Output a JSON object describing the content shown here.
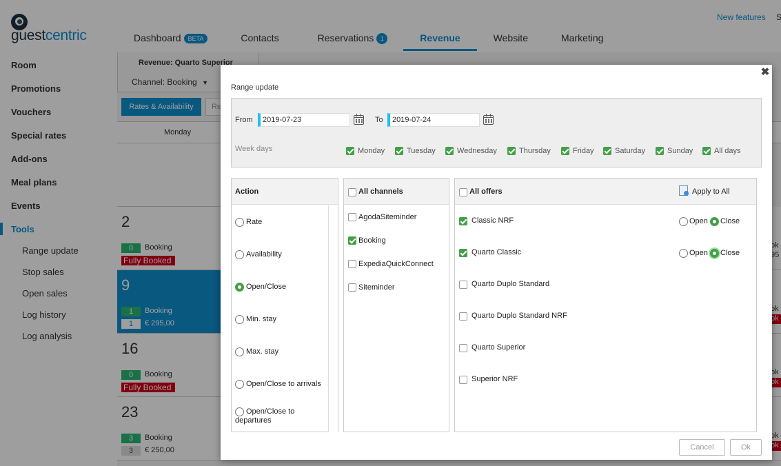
{
  "app": {
    "logo_word_a": "guest",
    "logo_word_b": "centric",
    "new_features": "New features",
    "user_initial": "S",
    "nav": [
      {
        "label": "Dashboard",
        "badge": "BETA"
      },
      {
        "label": "Contacts"
      },
      {
        "label": "Reservations",
        "count": "1"
      },
      {
        "label": "Revenue",
        "active": true
      },
      {
        "label": "Website"
      },
      {
        "label": "Marketing"
      }
    ],
    "sidebar": {
      "items": [
        "Room",
        "Promotions",
        "Vouchers",
        "Special rates",
        "Add-ons",
        "Meal plans",
        "Events",
        "Tools"
      ],
      "active": "Tools",
      "sub_items": [
        "Range update",
        "Stop sales",
        "Open sales",
        "Log history",
        "Log analysis"
      ]
    },
    "revenue": {
      "title": "Revenue: Quarto Superior",
      "channel": "Channel: Booking",
      "btn_rates": "Rates & Availability",
      "btn_other": "Re",
      "col_monday": "Monday"
    },
    "calendar": [
      {
        "day": "2",
        "qty": "0",
        "channel": "Booking",
        "status": "Fully Booked"
      },
      {
        "day": "9",
        "qty": "1",
        "channel": "Booking",
        "qty2": "1",
        "price": "€ 295,00",
        "selected": true
      },
      {
        "day": "16",
        "qty": "0",
        "channel": "Booking",
        "status": "Fully Booked"
      },
      {
        "day": "23",
        "qty": "3",
        "channel": "Booking",
        "qty2": "3",
        "price": "€ 250,00"
      }
    ],
    "right_col": [
      [
        "ok",
        "95"
      ],
      [
        "ok",
        "ok"
      ],
      [
        "ok",
        "ok"
      ],
      [
        "ok",
        "ok"
      ]
    ]
  },
  "modal": {
    "title": "Range update",
    "from_label": "From",
    "from_value": "2019-07-23",
    "to_label": "To",
    "to_value": "2019-07-24",
    "weekdays_label": "Week days",
    "weekdays": [
      "Monday",
      "Tuesday",
      "Wednesday",
      "Thursday",
      "Friday",
      "Saturday",
      "Sunday",
      "All days"
    ],
    "action": {
      "header": "Action",
      "options": [
        "Rate",
        "Availability",
        "Open/Close",
        "Min. stay",
        "Max. stay",
        "Open/Close to arrivals",
        "Open/Close to departures"
      ],
      "selected": "Open/Close"
    },
    "channels": {
      "header": "All channels",
      "items": [
        {
          "label": "AgodaSiteminder",
          "checked": false
        },
        {
          "label": "Booking",
          "checked": true
        },
        {
          "label": "ExpediaQuickConnect",
          "checked": false
        },
        {
          "label": "Siteminder",
          "checked": false
        }
      ]
    },
    "offers": {
      "header": "All offers",
      "apply_all": "Apply to All",
      "open_label": "Open",
      "close_label": "Close",
      "items": [
        {
          "label": "Classic NRF",
          "checked": true,
          "state": "Close"
        },
        {
          "label": "Quarto Classic",
          "checked": true,
          "state": "Close"
        },
        {
          "label": "Quarto Duplo Standard",
          "checked": false
        },
        {
          "label": "Quarto Duplo Standard NRF",
          "checked": false
        },
        {
          "label": "Quarto Superior",
          "checked": false
        },
        {
          "label": "Superior NRF",
          "checked": false
        }
      ]
    },
    "cancel_label": "Cancel",
    "ok_label": "Ok",
    "colors": {
      "accent": "#0f8ecf",
      "check": "#43a047",
      "sold_out": "#d0021b"
    }
  }
}
